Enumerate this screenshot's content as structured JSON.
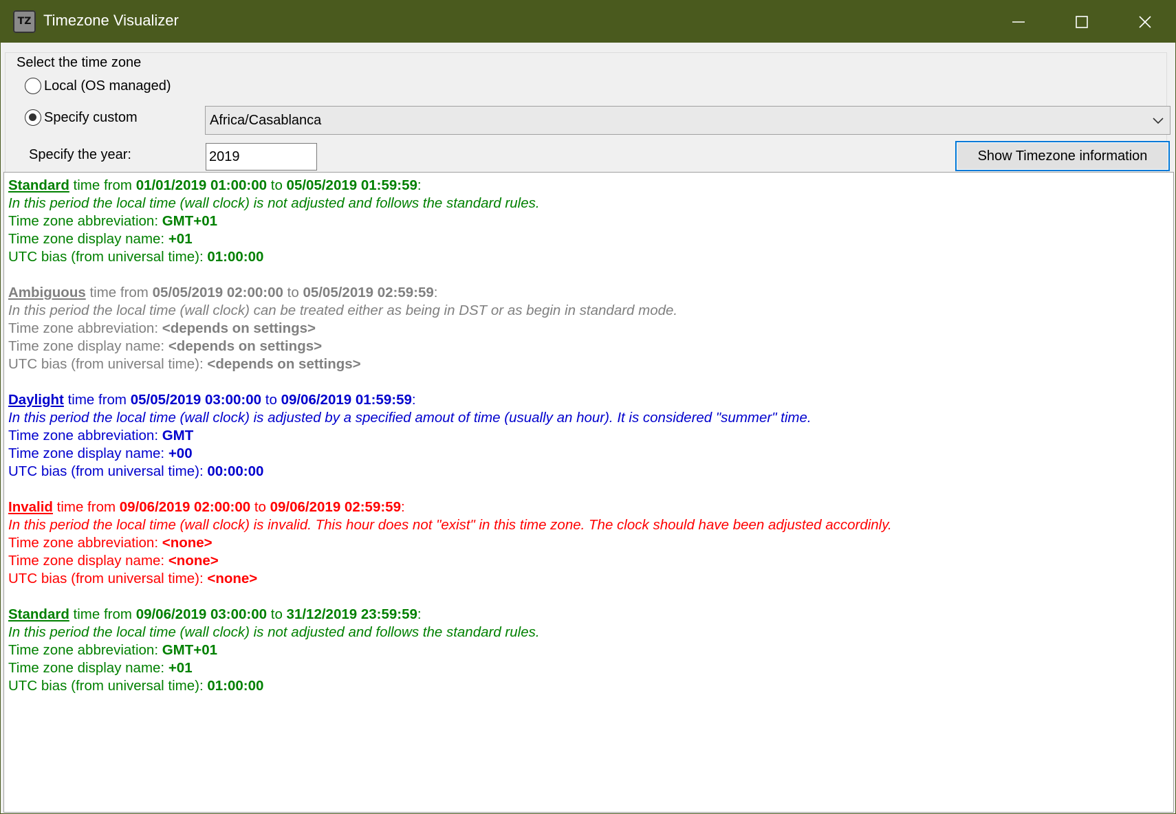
{
  "window": {
    "title": "Timezone Visualizer",
    "icon_text": "TZ",
    "minimize_glyph": "—",
    "maximize_glyph": "☐",
    "close_glyph": "✕"
  },
  "selector": {
    "group_title": "Select the time zone",
    "local_label": "Local (OS managed)",
    "local_checked": false,
    "custom_label": "Specify custom",
    "custom_checked": true,
    "timezone_value": "Africa/Casablanca",
    "year_label": "Specify the year:",
    "year_value": "2019",
    "show_button": "Show Timezone information"
  },
  "periods": [
    {
      "kind": "Standard",
      "color": "#008000",
      "time_from_label": " time from ",
      "from": "01/01/2019 01:00:00",
      "to_label": " to ",
      "to": "05/05/2019 01:59:59",
      "colon": ":",
      "description": "In this period the local time (wall clock) is not adjusted and follows the standard rules.",
      "abbr_label": "Time zone abbreviation: ",
      "abbr": "GMT+01",
      "display_label": "Time zone display name: ",
      "display": "+01",
      "bias_label": "UTC bias (from universal time): ",
      "bias": "01:00:00"
    },
    {
      "kind": "Ambiguous",
      "color": "#808080",
      "time_from_label": " time from ",
      "from": "05/05/2019 02:00:00",
      "to_label": " to ",
      "to": "05/05/2019 02:59:59",
      "colon": ":",
      "description": "In this period the local time (wall clock) can be treated either as being in DST or as begin in standard mode.",
      "abbr_label": "Time zone abbreviation: ",
      "abbr": "<depends on settings>",
      "display_label": "Time zone display name: ",
      "display": "<depends on settings>",
      "bias_label": "UTC bias (from universal time): ",
      "bias": "<depends on settings>"
    },
    {
      "kind": "Daylight",
      "color": "#0000cd",
      "time_from_label": " time from ",
      "from": "05/05/2019 03:00:00",
      "to_label": " to ",
      "to": "09/06/2019 01:59:59",
      "colon": ":",
      "description": "In this period the local time (wall clock) is adjusted by a specified amout of time (usually an hour). It is considered \"summer\" time.",
      "abbr_label": "Time zone abbreviation: ",
      "abbr": "GMT",
      "display_label": "Time zone display name: ",
      "display": "+00",
      "bias_label": "UTC bias (from universal time): ",
      "bias": "00:00:00"
    },
    {
      "kind": "Invalid",
      "color": "#ff0000",
      "time_from_label": " time from ",
      "from": "09/06/2019 02:00:00",
      "to_label": " to ",
      "to": "09/06/2019 02:59:59",
      "colon": ":",
      "description": "In this period the local time (wall clock) is invalid. This hour does not \"exist\" in this time zone. The clock should have been adjusted accordinly.",
      "abbr_label": "Time zone abbreviation: ",
      "abbr": "<none>",
      "display_label": "Time zone display name: ",
      "display": "<none>",
      "bias_label": "UTC bias (from universal time): ",
      "bias": "<none>"
    },
    {
      "kind": "Standard",
      "color": "#008000",
      "time_from_label": " time from ",
      "from": "09/06/2019 03:00:00",
      "to_label": " to ",
      "to": "31/12/2019 23:59:59",
      "colon": ":",
      "description": "In this period the local time (wall clock) is not adjusted and follows the standard rules.",
      "abbr_label": "Time zone abbreviation: ",
      "abbr": "GMT+01",
      "display_label": "Time zone display name: ",
      "display": "+01",
      "bias_label": "UTC bias (from universal time): ",
      "bias": "01:00:00"
    }
  ]
}
